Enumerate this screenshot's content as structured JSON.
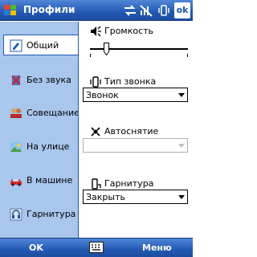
{
  "window": {
    "title": "Профили",
    "ok_label": "ok"
  },
  "sidebar": {
    "items": [
      {
        "label": "Общий",
        "icon": "general-profile-icon",
        "active": true
      },
      {
        "label": "Без звука",
        "icon": "silent-profile-icon",
        "active": false
      },
      {
        "label": "Совещание",
        "icon": "meeting-profile-icon",
        "active": false
      },
      {
        "label": "На улице",
        "icon": "outdoor-profile-icon",
        "active": false
      },
      {
        "label": "В машине",
        "icon": "car-profile-icon",
        "active": false
      },
      {
        "label": "Гарнитура",
        "icon": "headset-profile-icon",
        "active": false
      }
    ]
  },
  "settings": {
    "volume": {
      "label": "Громкость",
      "level": 0.15
    },
    "ring_type": {
      "label": "Тип звонка",
      "value": "Звонок"
    },
    "auto_answer": {
      "label": "Автоснятие",
      "value": "",
      "enabled": false
    },
    "headset": {
      "label": "Гарнитура",
      "value": "Закрыть"
    }
  },
  "softkeys": {
    "left": "OK",
    "right": "Меню"
  },
  "colors": {
    "titlebar": "#2459b3",
    "sidebar": "#a9c6ec",
    "text": "#000000"
  }
}
